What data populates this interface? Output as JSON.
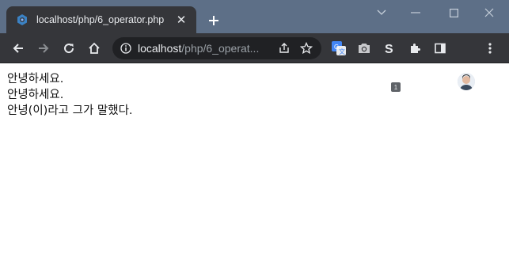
{
  "browser": {
    "tab": {
      "title": "localhost/php/6_operator.php",
      "close_glyph": "✕",
      "favicon": "php-favicon-icon"
    },
    "new_tab_glyph": "+",
    "address": {
      "host": "localhost",
      "path": "/php/6_operat..."
    },
    "extension_badge": "1",
    "colors": {
      "frame": "#5d6f87",
      "toolbar": "#35363a",
      "omnibox": "#202124"
    }
  },
  "page": {
    "lines": [
      "안녕하세요.",
      "안녕하세요.",
      "안녕(이)라고 그가 말했다."
    ]
  }
}
